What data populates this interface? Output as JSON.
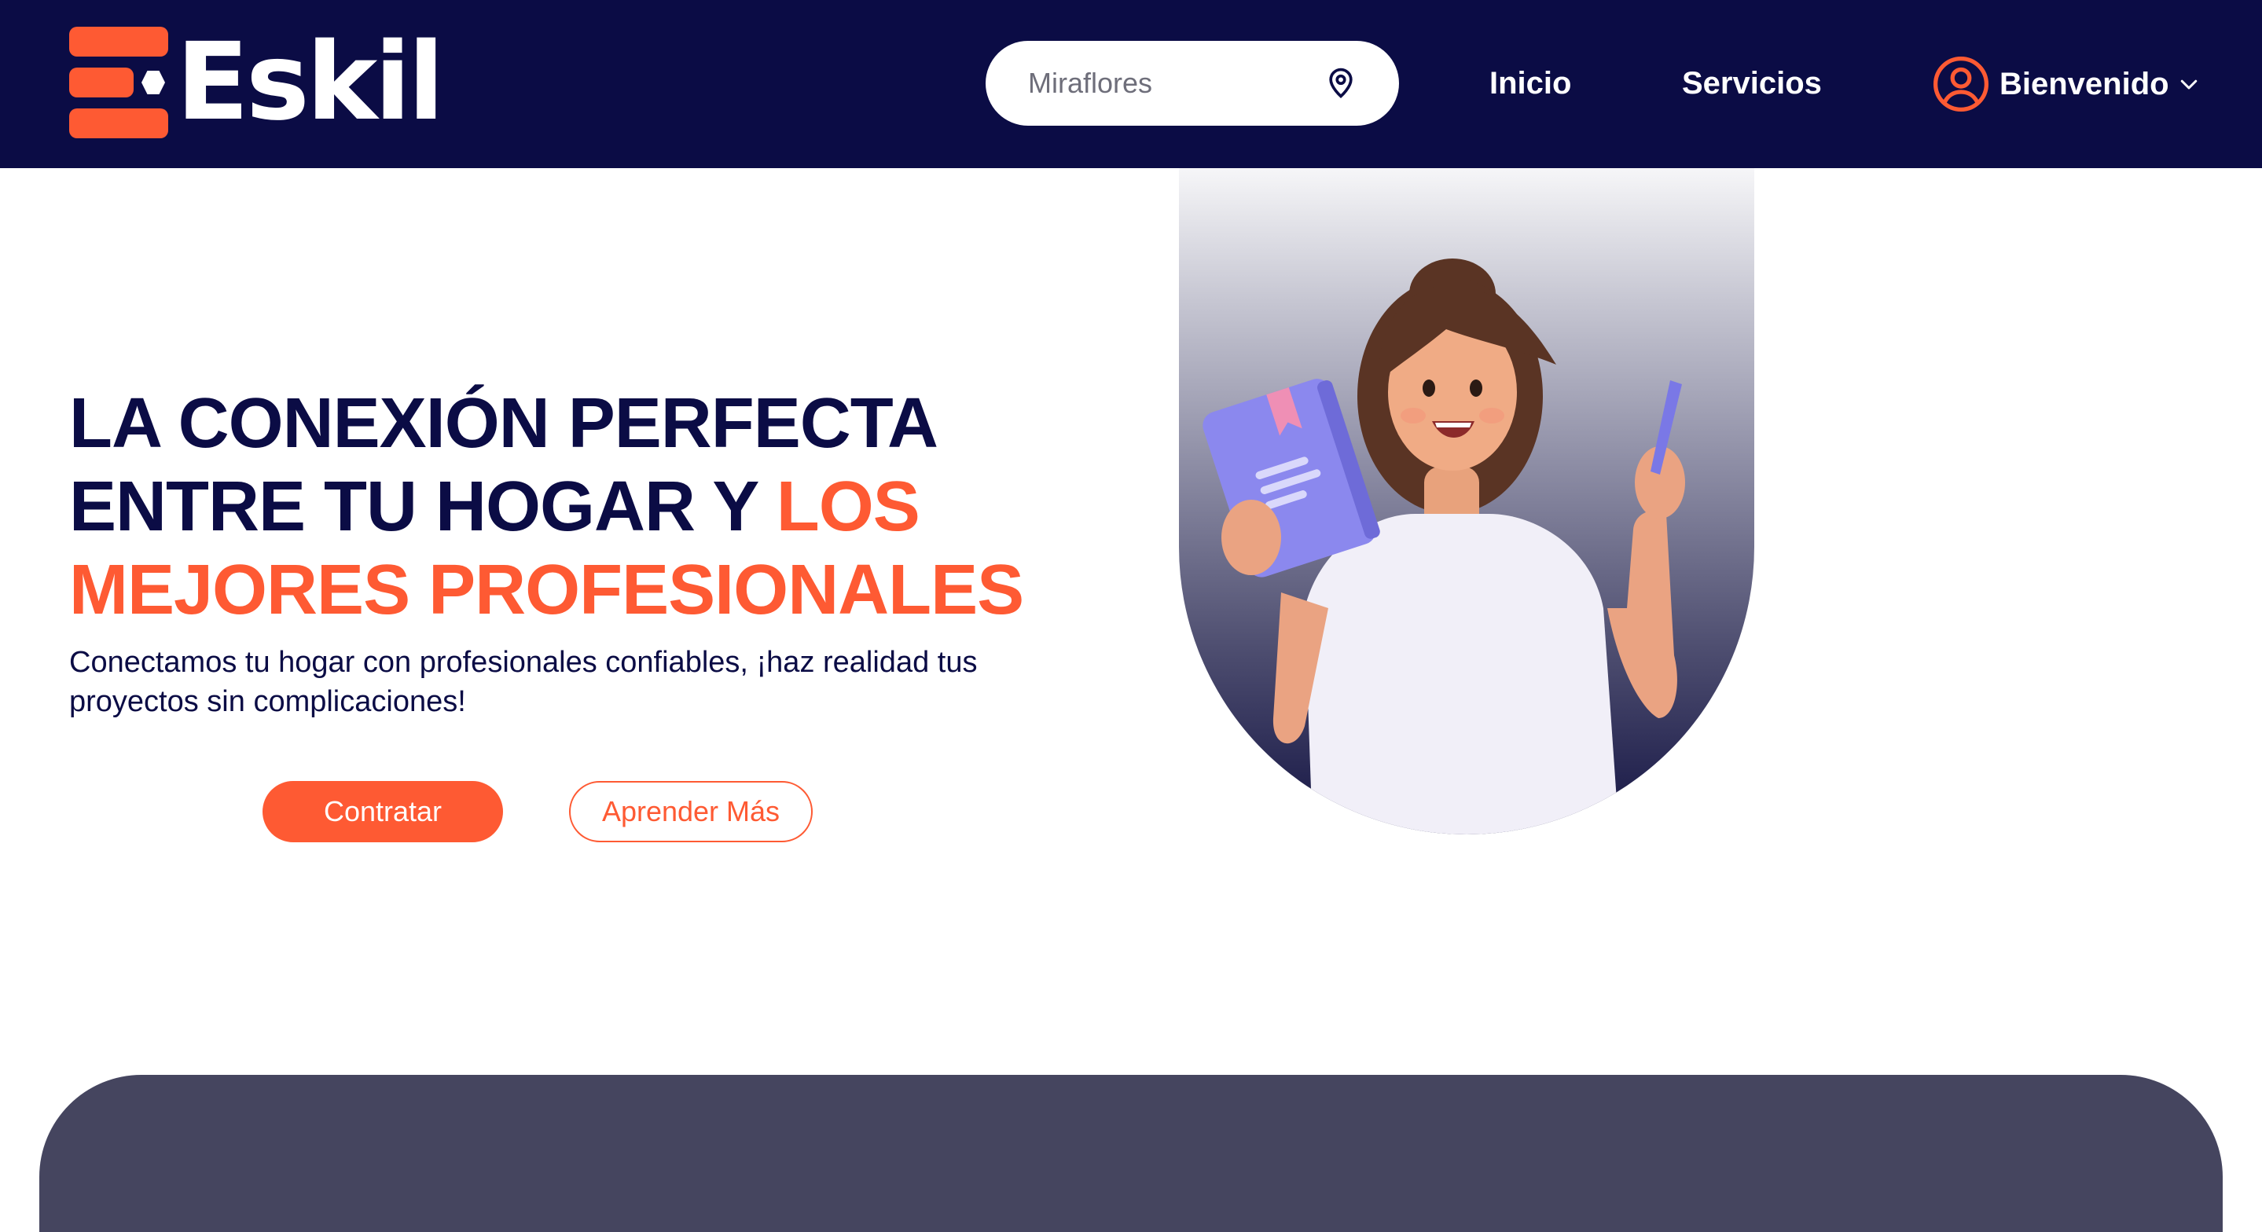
{
  "brand": {
    "name": "Eskil",
    "accent_color": "#fe5a33",
    "navy_color": "#0b0c45"
  },
  "header": {
    "search": {
      "placeholder": "Miraflores",
      "icon": "location-pin-icon"
    },
    "nav": [
      {
        "label": "Inicio"
      },
      {
        "label": "Servicios"
      }
    ],
    "user_menu": {
      "label": "Bienvenido",
      "icon": "user-circle-icon",
      "caret": "chevron-down-icon"
    }
  },
  "hero": {
    "title_line1": "LA CONEXIÓN PERFECTA",
    "title_line2": "ENTRE TU HOGAR Y ",
    "title_accent1": "LOS",
    "title_accent2": "MEJORES PROFESIONALES",
    "subtitle": "Conectamos tu hogar con profesionales confiables, ¡haz realidad tus proyectos sin complicaciones!",
    "primary_button": "Contratar",
    "secondary_button": "Aprender Más",
    "illustration": "woman-with-book-and-pen-illustration"
  }
}
